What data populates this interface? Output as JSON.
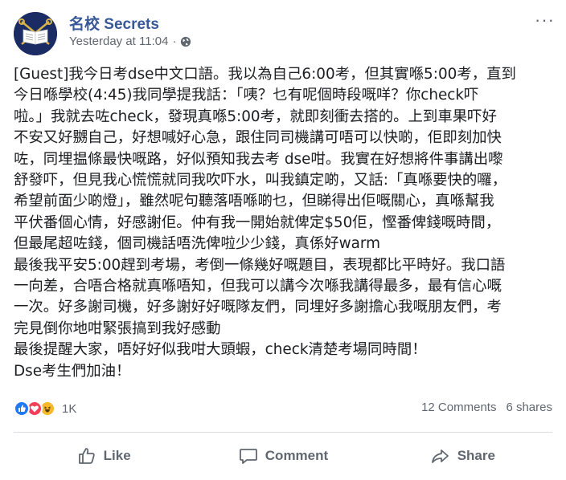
{
  "header": {
    "page_name": "名校 Secrets",
    "timestamp": "Yesterday at 11:04",
    "separator": "·",
    "more": "···"
  },
  "post": {
    "lines": [
      "[Guest]我今日考dse中文口語。我以為自己6:00考，但其實喺5:00考，直到",
      "今日喺學校(4:45)我同學提我話：「咦？乜有呢個時段嘅咩？你check吓",
      "啦。」我就去咗check，發現真喺5:00考，就即刻衝去搭的。上到車果吓好",
      "不安又好嬲自己，好想喊好心急，跟住同司機講可唔可以快啲，佢即刻加快",
      "咗，同埋揾條最快嘅路，好似預知我去考 dse咁。我實在好想將件事講出嚟",
      "舒發吓，但見我心慌慌就同我吹吓水，叫我鎮定啲，又話:「真喺要快的囉，",
      "希望前面少啲燈」，雖然呢句聽落唔喺啲乜，但睇得出佢嘅關心，真喺幫我",
      "平伏番個心情，好感謝佢。仲有我一開始就俾定$50佢，慳番俾錢嘅時間，",
      "但最尾超咗錢，個司機話唔洗俾啦少少錢，真係好warm",
      "最後我平安5:00趕到考場，考倒一條幾好嘅題目，表現都比平時好。我口語",
      "一向差，合唔合格就真喺唔知，但我可以講今次喺我講得最多，最有信心嘅",
      "一次。好多謝司機，好多謝好好嘅隊友們，同埋好多謝擔心我嘅朋友們，考",
      "完見倒你地咁緊張搞到我好感動",
      "最後提醒大家，唔好好似我咁大頭蝦，check清楚考場同時間！",
      "Dse考生們加油！"
    ]
  },
  "reactions": {
    "count": "1K",
    "types": [
      "like",
      "love",
      "haha"
    ]
  },
  "stats": {
    "comments": "12 Comments",
    "shares": "6 shares"
  },
  "actions": {
    "like": "Like",
    "comment": "Comment",
    "share": "Share"
  },
  "colors": {
    "page_name": "#385898",
    "like_reaction": "#2078f4",
    "love_reaction": "#f33e58",
    "haha_reaction": "#f7b928",
    "secondary_text": "#606770"
  }
}
